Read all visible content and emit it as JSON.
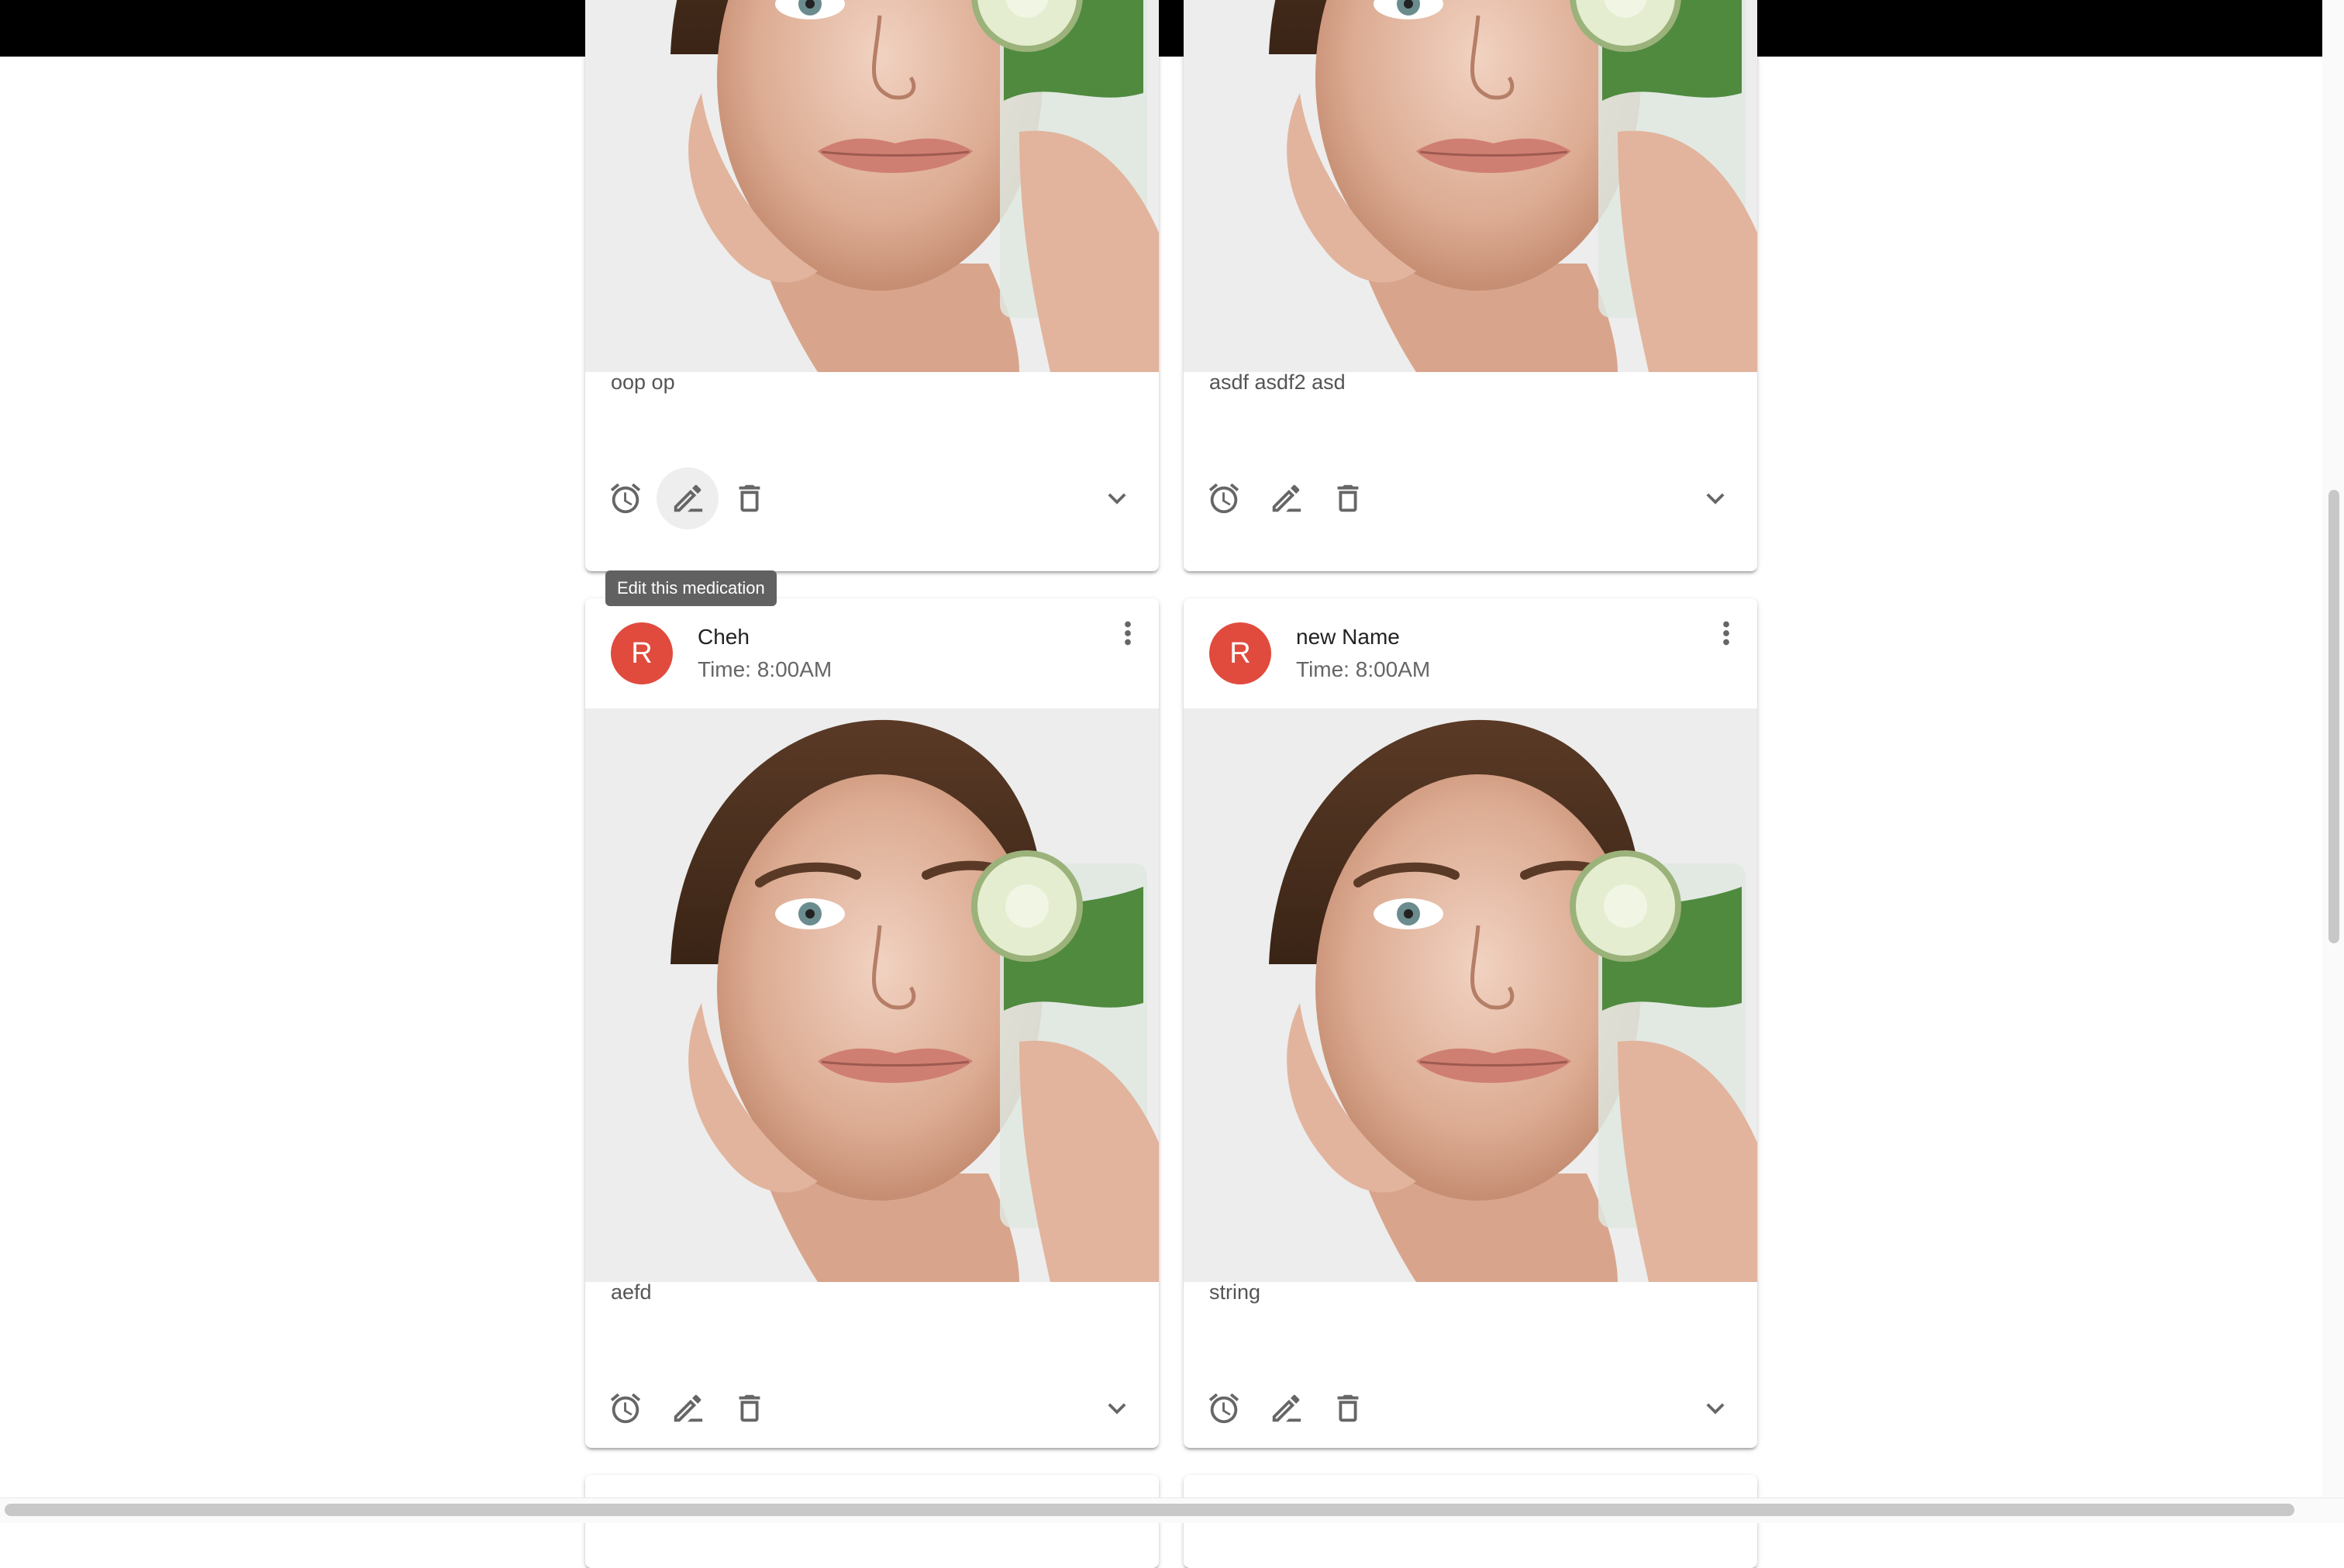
{
  "cards": [
    {
      "title": "",
      "subheader": "",
      "avatar_letter": "",
      "description": "oop op"
    },
    {
      "title": "",
      "subheader": "",
      "avatar_letter": "",
      "description": "asdf asdf2 asd"
    },
    {
      "title": "Cheh",
      "subheader": "Time: 8:00AM",
      "avatar_letter": "R",
      "description": "aefd"
    },
    {
      "title": "new Name",
      "subheader": "Time: 8:00AM",
      "avatar_letter": "R",
      "description": "string"
    }
  ],
  "tooltip": {
    "text": "Edit this medication"
  },
  "icons": {
    "alarm": "alarm-icon",
    "edit": "edit-icon",
    "delete": "delete-icon",
    "expand": "chevron-down-icon",
    "more": "more-vert-icon"
  },
  "colors": {
    "avatar_bg": "#e04b3e",
    "icon": "#666666",
    "tooltip_bg": "#616161"
  }
}
